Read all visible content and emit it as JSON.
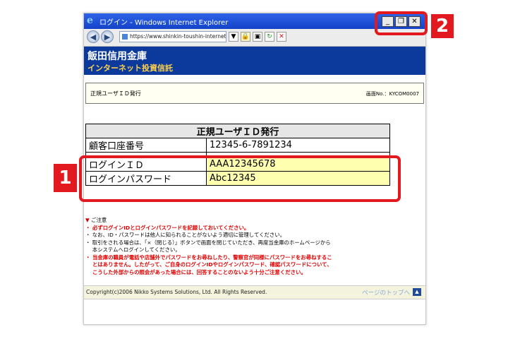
{
  "window": {
    "title": "ログイン - Windows Internet Explorer",
    "ie_icon": "ie-logo-icon",
    "controls": {
      "minimize": "_",
      "restore": "❐",
      "close": "✕"
    }
  },
  "browser": {
    "back": "◀",
    "forward": "▶",
    "address": "https://www.shinkin-toushin-internet.jp",
    "dropdown": "▼",
    "lock": "🔒",
    "refresh": "↻",
    "stop": "✕"
  },
  "banner": {
    "bank_name": "飯田信用金庫",
    "service": "インターネット投資信託",
    "color": "#0c3a9c"
  },
  "screen": {
    "title": "正規ユーザＩＤ発行",
    "id": "画面No.：KYCOM0007"
  },
  "table": {
    "header": "正規ユーザＩＤ発行",
    "rows": [
      {
        "label": "顧客口座番号",
        "value": "12345-6-7891234"
      },
      {
        "label": "ログインＩＤ",
        "value": "AAA12345678"
      },
      {
        "label": "ログインパスワード",
        "value": "Abc12345"
      }
    ]
  },
  "notes": {
    "heading_mark": "▼",
    "heading": "ご注意",
    "items": [
      {
        "text": "・ 必ずログインIDとログインパスワードを記録しておいてください。",
        "red": true
      },
      {
        "text": "・ なお、ID・パスワードは他人に知られることがないよう適切に管理してください。",
        "red": false
      },
      {
        "text": "・ 取引をされる場合は、「×（閉じる）」ボタンで画面を閉じていただき、再度当金庫のホームページから",
        "red": false
      },
      {
        "text": "　 本システムへログインしてください。",
        "red": false
      },
      {
        "text": "・ 当金庫の職員が電話や店舗外でパスワードをお尋ねしたり、警察官が同様にパスワードをお尋ねするこ",
        "red": true
      },
      {
        "text": "　 とはありません。したがって、ご自身のログインIDやログインパスワード、確認パスワードについて、",
        "red": true
      },
      {
        "text": "　 こうした外部からの照会があった場合には、回答することのないよう十分ご注意ください。",
        "red": true
      }
    ]
  },
  "footer": {
    "copyright": "Copyright(c)2006 Nikko Systems Solutions, Ltd. All Rights Reserved.",
    "to_top": "ページのトップへ",
    "up_icon": "▲"
  },
  "callouts": {
    "one": "1",
    "two": "2",
    "color": "#e2191f"
  }
}
